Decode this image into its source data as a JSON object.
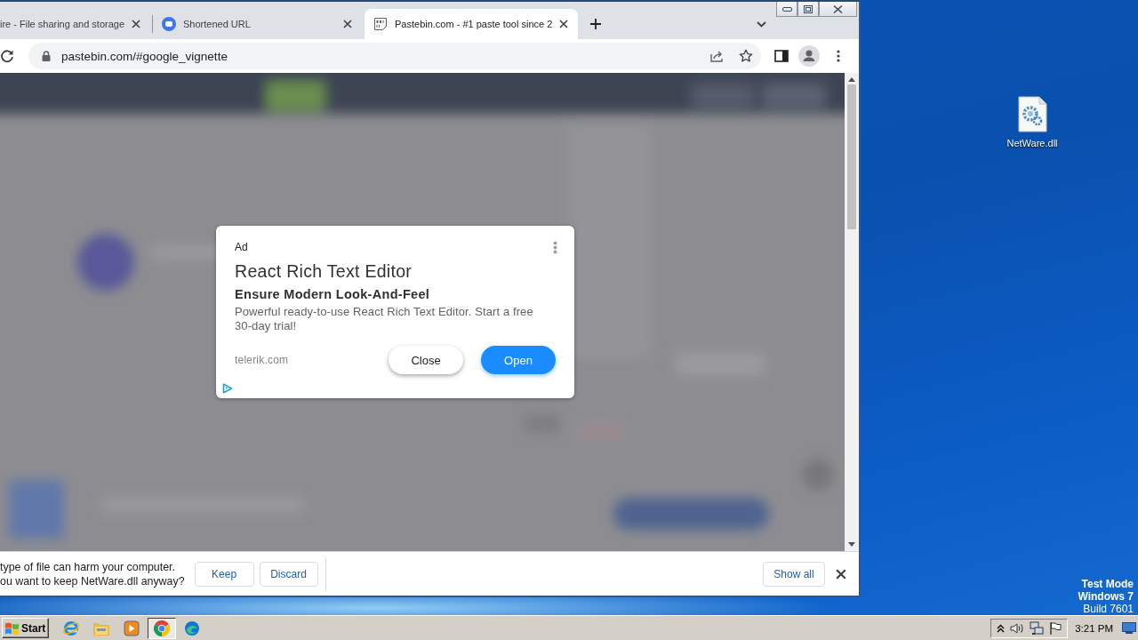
{
  "browser": {
    "tabs": [
      {
        "kind": "cut",
        "title": "ire - File sharing and storage",
        "selected": false
      },
      {
        "kind": "circle",
        "title": "Shortened URL",
        "selected": false
      },
      {
        "kind": "document",
        "title": "Pastebin.com - #1 paste tool since 2",
        "selected": true
      }
    ],
    "address_bar": {
      "url": "pastebin.com/#google_vignette"
    },
    "ad": {
      "label": "Ad",
      "title": "React Rich Text Editor",
      "subtitle": "Ensure Modern Look-And-Feel",
      "body": "Powerful ready-to-use React Rich Text Editor. Start a free 30-day trial!",
      "domain": "telerik.com",
      "buttons": [
        {
          "kind": "secondary",
          "label": "Close"
        },
        {
          "kind": "primary",
          "label": "Open"
        }
      ]
    },
    "download_bar": {
      "message": [
        "type of file can harm your computer.",
        "ou want to keep NetWare.dll anyway?"
      ],
      "buttons": [
        "Keep",
        "Discard"
      ],
      "show_all": "Show all"
    }
  },
  "desktop": {
    "icons": [
      {
        "label": "NetWare.dll"
      }
    ],
    "system_notice": [
      {
        "text": "Test Mode",
        "bold": true
      },
      {
        "text": "Windows 7",
        "bold": true
      },
      {
        "text": "Build 7601",
        "bold": false
      }
    ]
  },
  "taskbar": {
    "start": "Start",
    "apps": [
      {
        "kind": "globe",
        "selected": false
      },
      {
        "kind": "folder",
        "selected": false
      },
      {
        "kind": "player",
        "selected": false
      },
      {
        "kind": "wheel",
        "selected": true
      },
      {
        "kind": "swirl",
        "selected": false
      }
    ],
    "clock": "3:21 PM"
  }
}
